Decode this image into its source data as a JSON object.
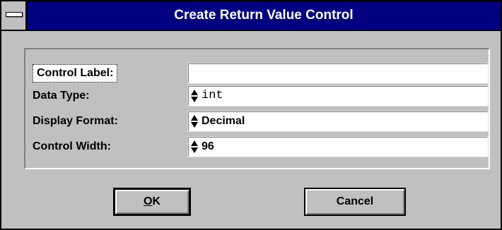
{
  "window": {
    "title": "Create Return Value Control",
    "system_menu_icon": "system-menu-bar-icon"
  },
  "form": {
    "rows": [
      {
        "label": "Control Label:",
        "value": "",
        "has_spinner": false,
        "focused": true
      },
      {
        "label": "Data Type:",
        "value": "int",
        "has_spinner": true,
        "monospace": true
      },
      {
        "label": "Display Format:",
        "value": "Decimal",
        "has_spinner": true
      },
      {
        "label": "Control Width:",
        "value": "96",
        "has_spinner": true
      }
    ]
  },
  "buttons": {
    "ok_mnemonic": "O",
    "ok_rest": "K",
    "cancel_label": "Cancel"
  },
  "colors": {
    "titlebar": "#000080",
    "face": "#c0c0c0",
    "field": "#ffffff"
  }
}
